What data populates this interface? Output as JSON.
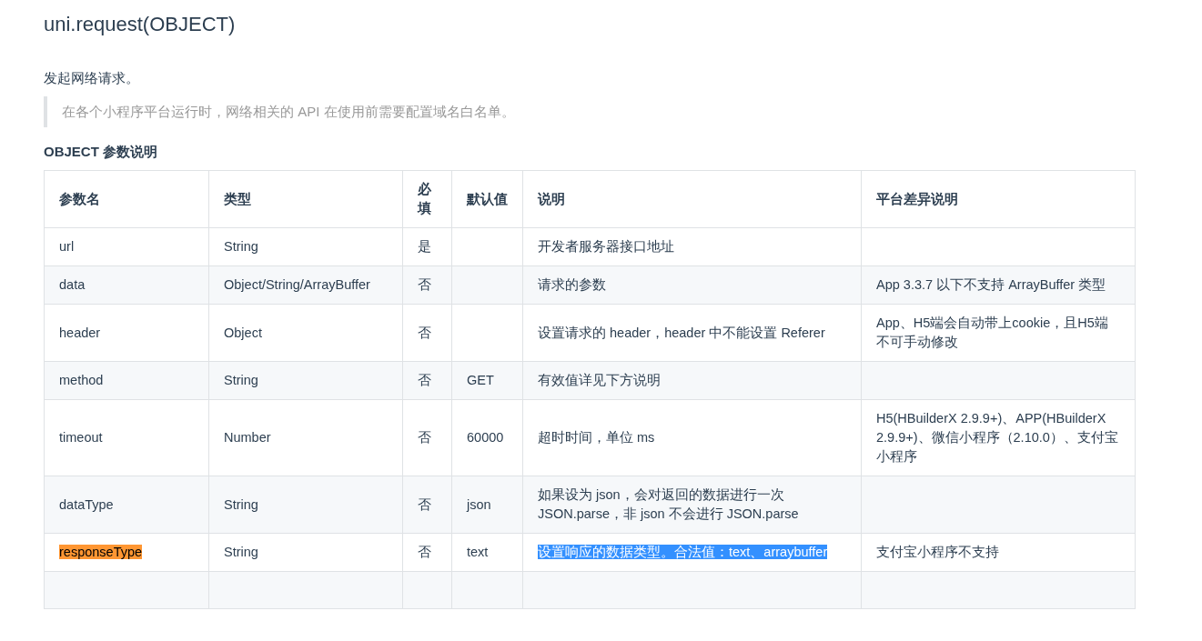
{
  "title": "uni.request(OBJECT)",
  "intro": "发起网络请求。",
  "note": "在各个小程序平台运行时，网络相关的 API 在使用前需要配置域名白名单。",
  "section_heading": "OBJECT 参数说明",
  "table": {
    "columns": [
      "参数名",
      "类型",
      "必填",
      "默认值",
      "说明",
      "平台差异说明"
    ],
    "rows": [
      {
        "name": "url",
        "type": "String",
        "required": "是",
        "default": "",
        "description": "开发者服务器接口地址",
        "platform": "",
        "name_highlighted": false,
        "description_selected": false
      },
      {
        "name": "data",
        "type": "Object/String/ArrayBuffer",
        "required": "否",
        "default": "",
        "description": "请求的参数",
        "platform": "App 3.3.7 以下不支持 ArrayBuffer 类型",
        "name_highlighted": false,
        "description_selected": false
      },
      {
        "name": "header",
        "type": "Object",
        "required": "否",
        "default": "",
        "description": "设置请求的 header，header 中不能设置 Referer",
        "platform": "App、H5端会自动带上cookie，且H5端不可手动修改",
        "name_highlighted": false,
        "description_selected": false
      },
      {
        "name": "method",
        "type": "String",
        "required": "否",
        "default": "GET",
        "description": "有效值详见下方说明",
        "platform": "",
        "name_highlighted": false,
        "description_selected": false
      },
      {
        "name": "timeout",
        "type": "Number",
        "required": "否",
        "default": "60000",
        "description": "超时时间，单位 ms",
        "platform": "H5(HBuilderX 2.9.9+)、APP(HBuilderX 2.9.9+)、微信小程序（2.10.0）、支付宝小程序",
        "name_highlighted": false,
        "description_selected": false
      },
      {
        "name": "dataType",
        "type": "String",
        "required": "否",
        "default": "json",
        "description": "如果设为 json，会对返回的数据进行一次 JSON.parse，非 json 不会进行 JSON.parse",
        "platform": "",
        "name_highlighted": false,
        "description_selected": false
      },
      {
        "name": "responseType",
        "type": "String",
        "required": "否",
        "default": "text",
        "description": "设置响应的数据类型。合法值：text、arraybuffer",
        "platform": "支付宝小程序不支持",
        "name_highlighted": true,
        "description_selected": true
      },
      {
        "name": "",
        "type": "",
        "required": "",
        "default": "",
        "description": "",
        "platform": ""
      }
    ]
  }
}
